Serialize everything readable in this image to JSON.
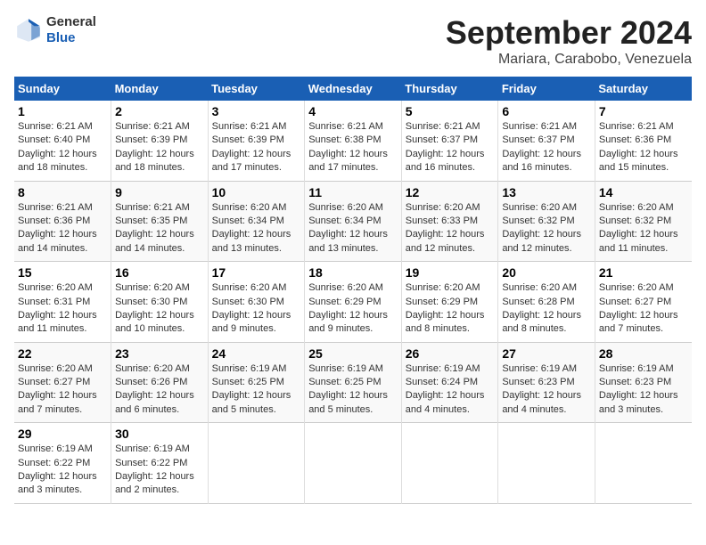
{
  "logo": {
    "general": "General",
    "blue": "Blue"
  },
  "title": "September 2024",
  "location": "Mariara, Carabobo, Venezuela",
  "weekdays": [
    "Sunday",
    "Monday",
    "Tuesday",
    "Wednesday",
    "Thursday",
    "Friday",
    "Saturday"
  ],
  "weeks": [
    [
      {
        "day": "1",
        "info": "Sunrise: 6:21 AM\nSunset: 6:40 PM\nDaylight: 12 hours\nand 18 minutes."
      },
      {
        "day": "2",
        "info": "Sunrise: 6:21 AM\nSunset: 6:39 PM\nDaylight: 12 hours\nand 18 minutes."
      },
      {
        "day": "3",
        "info": "Sunrise: 6:21 AM\nSunset: 6:39 PM\nDaylight: 12 hours\nand 17 minutes."
      },
      {
        "day": "4",
        "info": "Sunrise: 6:21 AM\nSunset: 6:38 PM\nDaylight: 12 hours\nand 17 minutes."
      },
      {
        "day": "5",
        "info": "Sunrise: 6:21 AM\nSunset: 6:37 PM\nDaylight: 12 hours\nand 16 minutes."
      },
      {
        "day": "6",
        "info": "Sunrise: 6:21 AM\nSunset: 6:37 PM\nDaylight: 12 hours\nand 16 minutes."
      },
      {
        "day": "7",
        "info": "Sunrise: 6:21 AM\nSunset: 6:36 PM\nDaylight: 12 hours\nand 15 minutes."
      }
    ],
    [
      {
        "day": "8",
        "info": "Sunrise: 6:21 AM\nSunset: 6:36 PM\nDaylight: 12 hours\nand 14 minutes."
      },
      {
        "day": "9",
        "info": "Sunrise: 6:21 AM\nSunset: 6:35 PM\nDaylight: 12 hours\nand 14 minutes."
      },
      {
        "day": "10",
        "info": "Sunrise: 6:20 AM\nSunset: 6:34 PM\nDaylight: 12 hours\nand 13 minutes."
      },
      {
        "day": "11",
        "info": "Sunrise: 6:20 AM\nSunset: 6:34 PM\nDaylight: 12 hours\nand 13 minutes."
      },
      {
        "day": "12",
        "info": "Sunrise: 6:20 AM\nSunset: 6:33 PM\nDaylight: 12 hours\nand 12 minutes."
      },
      {
        "day": "13",
        "info": "Sunrise: 6:20 AM\nSunset: 6:32 PM\nDaylight: 12 hours\nand 12 minutes."
      },
      {
        "day": "14",
        "info": "Sunrise: 6:20 AM\nSunset: 6:32 PM\nDaylight: 12 hours\nand 11 minutes."
      }
    ],
    [
      {
        "day": "15",
        "info": "Sunrise: 6:20 AM\nSunset: 6:31 PM\nDaylight: 12 hours\nand 11 minutes."
      },
      {
        "day": "16",
        "info": "Sunrise: 6:20 AM\nSunset: 6:30 PM\nDaylight: 12 hours\nand 10 minutes."
      },
      {
        "day": "17",
        "info": "Sunrise: 6:20 AM\nSunset: 6:30 PM\nDaylight: 12 hours\nand 9 minutes."
      },
      {
        "day": "18",
        "info": "Sunrise: 6:20 AM\nSunset: 6:29 PM\nDaylight: 12 hours\nand 9 minutes."
      },
      {
        "day": "19",
        "info": "Sunrise: 6:20 AM\nSunset: 6:29 PM\nDaylight: 12 hours\nand 8 minutes."
      },
      {
        "day": "20",
        "info": "Sunrise: 6:20 AM\nSunset: 6:28 PM\nDaylight: 12 hours\nand 8 minutes."
      },
      {
        "day": "21",
        "info": "Sunrise: 6:20 AM\nSunset: 6:27 PM\nDaylight: 12 hours\nand 7 minutes."
      }
    ],
    [
      {
        "day": "22",
        "info": "Sunrise: 6:20 AM\nSunset: 6:27 PM\nDaylight: 12 hours\nand 7 minutes."
      },
      {
        "day": "23",
        "info": "Sunrise: 6:20 AM\nSunset: 6:26 PM\nDaylight: 12 hours\nand 6 minutes."
      },
      {
        "day": "24",
        "info": "Sunrise: 6:19 AM\nSunset: 6:25 PM\nDaylight: 12 hours\nand 5 minutes."
      },
      {
        "day": "25",
        "info": "Sunrise: 6:19 AM\nSunset: 6:25 PM\nDaylight: 12 hours\nand 5 minutes."
      },
      {
        "day": "26",
        "info": "Sunrise: 6:19 AM\nSunset: 6:24 PM\nDaylight: 12 hours\nand 4 minutes."
      },
      {
        "day": "27",
        "info": "Sunrise: 6:19 AM\nSunset: 6:23 PM\nDaylight: 12 hours\nand 4 minutes."
      },
      {
        "day": "28",
        "info": "Sunrise: 6:19 AM\nSunset: 6:23 PM\nDaylight: 12 hours\nand 3 minutes."
      }
    ],
    [
      {
        "day": "29",
        "info": "Sunrise: 6:19 AM\nSunset: 6:22 PM\nDaylight: 12 hours\nand 3 minutes."
      },
      {
        "day": "30",
        "info": "Sunrise: 6:19 AM\nSunset: 6:22 PM\nDaylight: 12 hours\nand 2 minutes."
      },
      {
        "day": "",
        "info": ""
      },
      {
        "day": "",
        "info": ""
      },
      {
        "day": "",
        "info": ""
      },
      {
        "day": "",
        "info": ""
      },
      {
        "day": "",
        "info": ""
      }
    ]
  ]
}
